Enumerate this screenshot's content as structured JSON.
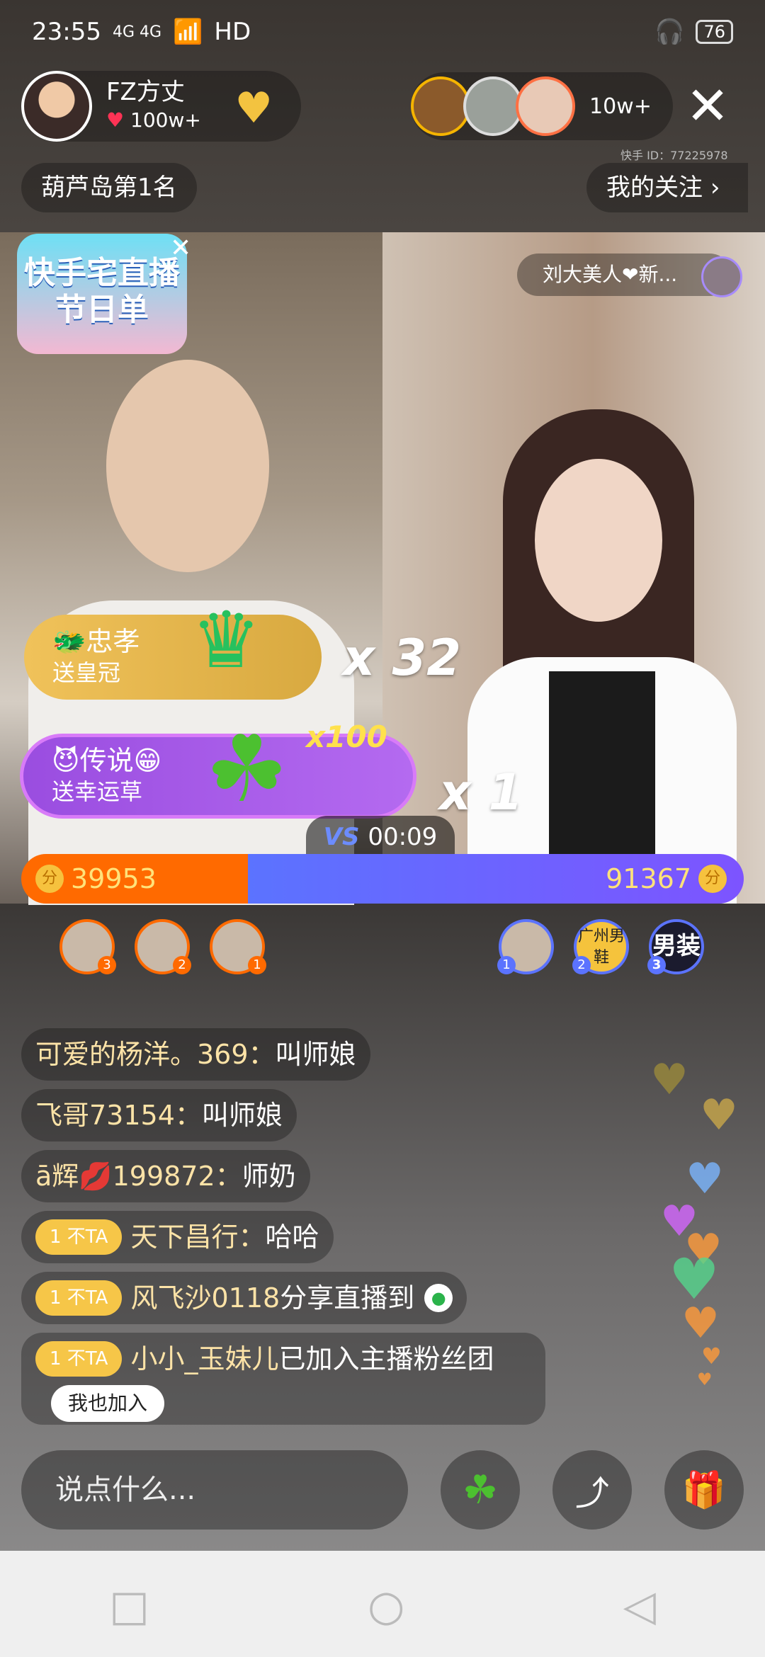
{
  "status": {
    "time": "23:55",
    "signal": "4G 4G",
    "network": "HD",
    "battery": "76"
  },
  "host": {
    "name": "FZ方丈",
    "likes": "100w+"
  },
  "viewers": {
    "count": "10w+",
    "colors": [
      "#f5b400",
      "#dddddd",
      "#ff7043"
    ]
  },
  "kuaishou_id": "快手 ID：77225978",
  "rank_label": "葫芦岛第1名",
  "follow_label": "我的关注",
  "partner": {
    "label": "刘大美人❤新..."
  },
  "festival_banner": "快手宅直播\n节日单",
  "gifts": [
    {
      "sender": "忠孝",
      "desc": "送皇冠",
      "multiplier": "x 32"
    },
    {
      "sender": "传说😁",
      "desc": "送幸运草",
      "bonus": "x100",
      "multiplier": "x 1"
    }
  ],
  "vs_timer": "00:09",
  "score": {
    "left": "39953",
    "right": "91367",
    "left_fraction": 0.304,
    "coin": "分"
  },
  "supporters_left": [
    {
      "rank": "3"
    },
    {
      "rank": "2"
    },
    {
      "rank": "1"
    }
  ],
  "supporters_right": [
    {
      "rank": "1",
      "text": ""
    },
    {
      "rank": "2",
      "text": "广州男鞋"
    },
    {
      "rank": "3",
      "text": "男装"
    }
  ],
  "chat": [
    {
      "nick": "可爱的杨洋。369：",
      "msg": "叫师娘"
    },
    {
      "nick": "飞哥73154：",
      "msg": "叫师娘"
    },
    {
      "nick": "ā辉💋199872：",
      "msg": "师奶"
    },
    {
      "fan": "1  不TA",
      "nick": "天下昌行：",
      "msg": "哈哈"
    },
    {
      "fan": "1  不TA",
      "nick": "风飞沙0118 ",
      "msg": "分享直播到"
    },
    {
      "fan": "1  不TA",
      "nick": "小小_玉妹儿 ",
      "msg": "已加入主播粉丝团"
    }
  ],
  "join_button": "我也加入",
  "input_placeholder": "说点什么...",
  "icons": [
    "clover-icon",
    "share-icon",
    "gift-icon"
  ]
}
